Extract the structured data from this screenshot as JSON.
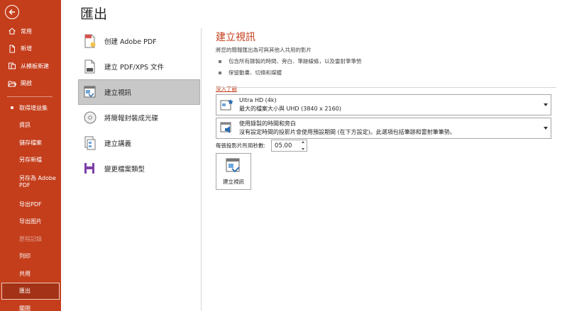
{
  "sidebar": {
    "top_items": [
      {
        "label": "常用",
        "icon": "home-icon"
      },
      {
        "label": "新增",
        "icon": "new-file-icon"
      },
      {
        "label": "从模板新建",
        "icon": "template-icon"
      },
      {
        "label": "開啟",
        "icon": "open-folder-icon"
      }
    ],
    "lower_items": [
      {
        "label": "取得增益集",
        "dot": true
      },
      {
        "label": "資訊"
      },
      {
        "label": "儲存檔案"
      },
      {
        "label": "另存新檔"
      },
      {
        "label": "另存為 Adobe PDF"
      },
      {
        "label": "导出PDF"
      },
      {
        "label": "导出图片"
      },
      {
        "label": "歷程記錄",
        "disabled": true
      },
      {
        "label": "列印"
      },
      {
        "label": "共用"
      },
      {
        "label": "匯出",
        "selected": true
      },
      {
        "label": "關閉"
      }
    ]
  },
  "page": {
    "title": "匯出"
  },
  "options": [
    {
      "label": "创建 Adobe PDF",
      "icon": "adobe-pdf-icon"
    },
    {
      "label": "建立 PDF/XPS 文件",
      "icon": "pdf-xps-icon"
    },
    {
      "label": "建立視訊",
      "icon": "video-icon",
      "selected": true
    },
    {
      "label": "將簡報封裝成光碟",
      "icon": "cd-icon"
    },
    {
      "label": "建立講義",
      "icon": "handout-icon"
    },
    {
      "label": "變更檔案類型",
      "icon": "change-type-icon"
    }
  ],
  "panel": {
    "title": "建立視訊",
    "subtitle": "將您的簡報匯出為可與其他人共用的影片",
    "bullets": [
      "包含所有錄製的時間、旁白、筆跡線條，以及雷射筆筆勢",
      "保留動畫、切換和媒體"
    ],
    "learn_more": "深入了解",
    "quality": {
      "title": "Ultra HD (4k)",
      "desc": "最大的檔案大小與 UHD (3840 x 2160)"
    },
    "timing": {
      "title": "使用錄製的時間和旁白",
      "desc": "沒有設定時間的投影片會使用預設期間 (在下方設定)。此選項包括筆跡和雷射筆筆勢。"
    },
    "seconds_label": "每張投影片所用秒數:",
    "seconds_value": "05.00",
    "create_button": "建立視訊"
  },
  "colors": {
    "accent": "#c43e1c"
  }
}
